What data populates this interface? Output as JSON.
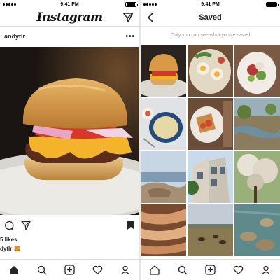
{
  "status_bar": {
    "time": "9:41 PM"
  },
  "feed": {
    "logo": "Instagram",
    "post": {
      "username": "andytlr",
      "more": "•••",
      "likes_text": "5 likes",
      "caption_user": "dytlr",
      "caption_text": "🍔"
    }
  },
  "saved": {
    "title": "Saved",
    "privacy_note": "Only you can see what you've saved",
    "thumbnails": [
      {
        "name": "burger-photo"
      },
      {
        "name": "eggs-plate-photo"
      },
      {
        "name": "salad-plate-photo"
      },
      {
        "name": "soup-bowl-photo"
      },
      {
        "name": "toast-plate-photo"
      },
      {
        "name": "creek-landscape-photo"
      },
      {
        "name": "coastal-rocks-photo"
      },
      {
        "name": "city-houses-photo"
      },
      {
        "name": "tree-blossom-photo"
      },
      {
        "name": "canyon-rock-photo"
      },
      {
        "name": "field-animals-photo"
      },
      {
        "name": "pond-rocks-photo"
      }
    ]
  }
}
